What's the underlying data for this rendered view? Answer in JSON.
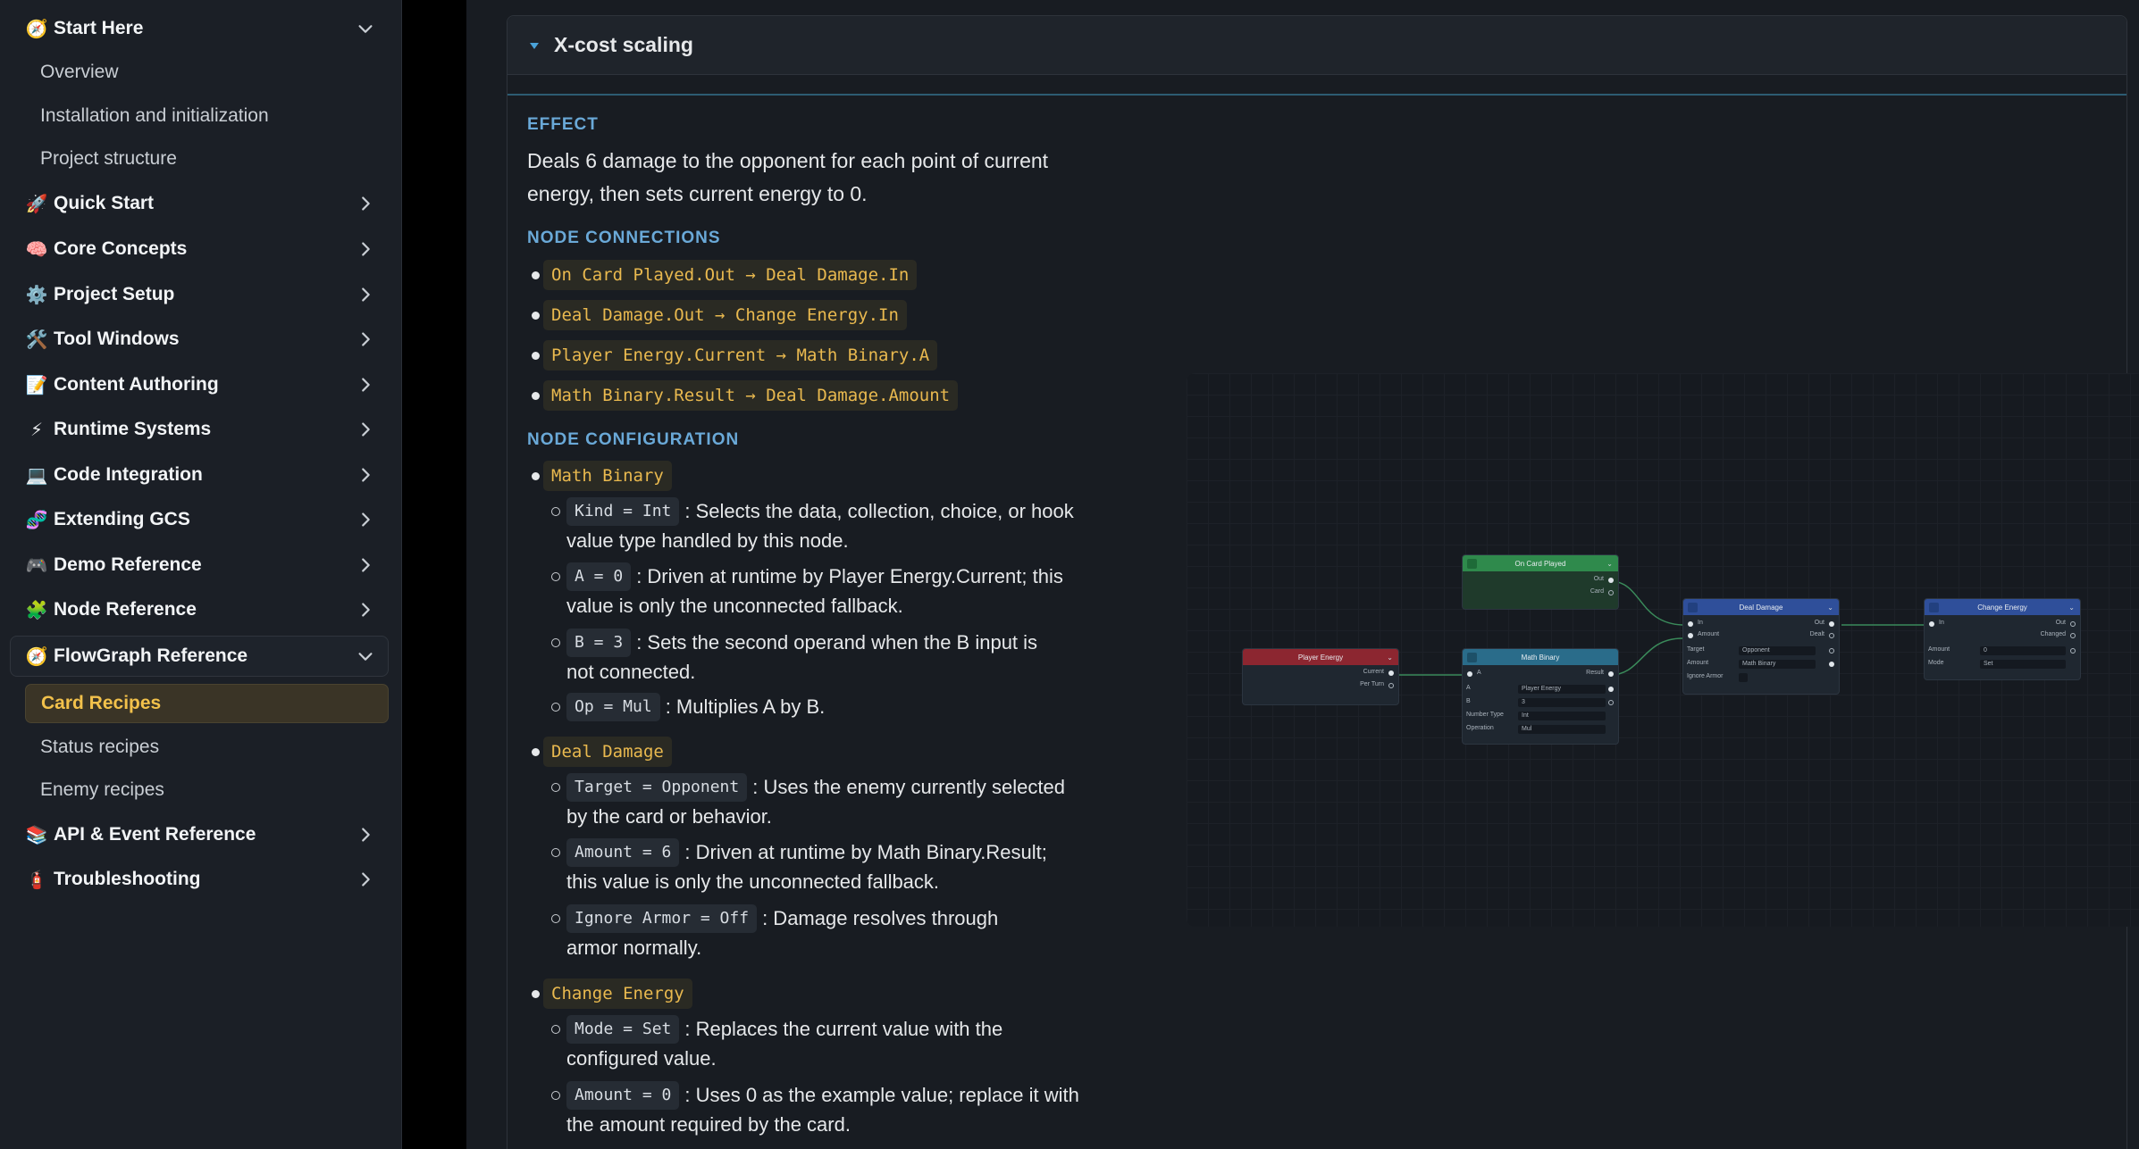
{
  "sidebar": {
    "start_here": {
      "emoji": "🧭",
      "label": "Start Here"
    },
    "start_here_children": [
      "Overview",
      "Installation and initialization",
      "Project structure"
    ],
    "groups": [
      {
        "emoji": "🚀",
        "label": "Quick Start"
      },
      {
        "emoji": "🧠",
        "label": "Core Concepts"
      },
      {
        "emoji": "⚙️",
        "label": "Project Setup"
      },
      {
        "emoji": "🛠️",
        "label": "Tool Windows"
      },
      {
        "emoji": "📝",
        "label": "Content Authoring"
      },
      {
        "emoji": "⚡",
        "label": "Runtime Systems"
      },
      {
        "emoji": "💻",
        "label": "Code Integration"
      },
      {
        "emoji": "🧬",
        "label": "Extending GCS"
      },
      {
        "emoji": "🎮",
        "label": "Demo Reference"
      },
      {
        "emoji": "🧩",
        "label": "Node Reference"
      }
    ],
    "flowgraph": {
      "emoji": "🧭",
      "label": "FlowGraph Reference"
    },
    "flowgraph_children": [
      "Card Recipes",
      "Status recipes",
      "Enemy recipes"
    ],
    "tail_groups": [
      {
        "emoji": "📚",
        "label": "API & Event Reference"
      },
      {
        "emoji": "🧯",
        "label": "Troubleshooting"
      }
    ]
  },
  "section": {
    "title": "X-cost scaling",
    "effect_heading": "EFFECT",
    "effect_text": "Deals 6 damage to the opponent for each point of current energy, then sets current energy to 0.",
    "connections_heading": "NODE CONNECTIONS",
    "connections": [
      "On Card Played.Out → Deal Damage.In",
      "Deal Damage.Out → Change Energy.In",
      "Player Energy.Current → Math Binary.A",
      "Math Binary.Result → Deal Damage.Amount"
    ],
    "config_heading": "NODE CONFIGURATION",
    "nodes": [
      {
        "name": "Math Binary",
        "settings": [
          {
            "code": "Kind = Int",
            "l1": ": Selects the data, collection, choice, or hook",
            "l2": "value type handled by this node."
          },
          {
            "code": "A = 0",
            "l1": ": Driven at runtime by Player Energy.Current; this",
            "l2": "value is only the unconnected fallback."
          },
          {
            "code": "B = 3",
            "l1": ": Sets the second operand when the B input is",
            "l2": "not connected."
          },
          {
            "code": "Op = Mul",
            "l1": ": Multiplies A by B.",
            "l2": ""
          }
        ]
      },
      {
        "name": "Deal Damage",
        "settings": [
          {
            "code": "Target = Opponent",
            "l1": ": Uses the enemy currently selected",
            "l2": "by the card or behavior."
          },
          {
            "code": "Amount = 6",
            "l1": ": Driven at runtime by Math Binary.Result;",
            "l2": "this value is only the unconnected fallback."
          },
          {
            "code": "Ignore Armor = Off",
            "l1": ": Damage resolves through",
            "l2": "armor normally."
          }
        ]
      },
      {
        "name": "Change Energy",
        "settings": [
          {
            "code": "Mode = Set",
            "l1": ": Replaces the current value with the",
            "l2": "configured value."
          },
          {
            "code": "Amount = 0",
            "l1": ": Uses 0 as the example value; replace it with",
            "l2": "the amount required by the card."
          }
        ]
      }
    ]
  },
  "graph": {
    "colors": {
      "event": "#2f8a4c",
      "value": "#8c2630",
      "math": "#2a6c8a",
      "action": "#2f4f9a"
    },
    "on_card_played": {
      "title": "On Card Played",
      "out": "Out",
      "card": "Card"
    },
    "player_energy": {
      "title": "Player Energy",
      "current": "Current",
      "per_turn": "Per Turn"
    },
    "math_binary": {
      "title": "Math Binary",
      "a": "A",
      "result": "Result",
      "a_field": "A",
      "a_value": "Player Energy",
      "b_field": "B",
      "b_value": "3",
      "type_field": "Number Type",
      "type_value": "Int",
      "op_field": "Operation",
      "op_value": "Mul"
    },
    "deal_damage": {
      "title": "Deal Damage",
      "in": "In",
      "out": "Out",
      "amount": "Amount",
      "dealt": "Dealt",
      "target_field": "Target",
      "target_value": "Opponent",
      "amount_field": "Amount",
      "amount_value": "Math Binary",
      "armor_field": "Ignore Armor"
    },
    "change_energy": {
      "title": "Change Energy",
      "in": "In",
      "out": "Out",
      "changed": "Changed",
      "amount_field": "Amount",
      "amount_value": "0",
      "mode_field": "Mode",
      "mode_value": "Set"
    }
  }
}
